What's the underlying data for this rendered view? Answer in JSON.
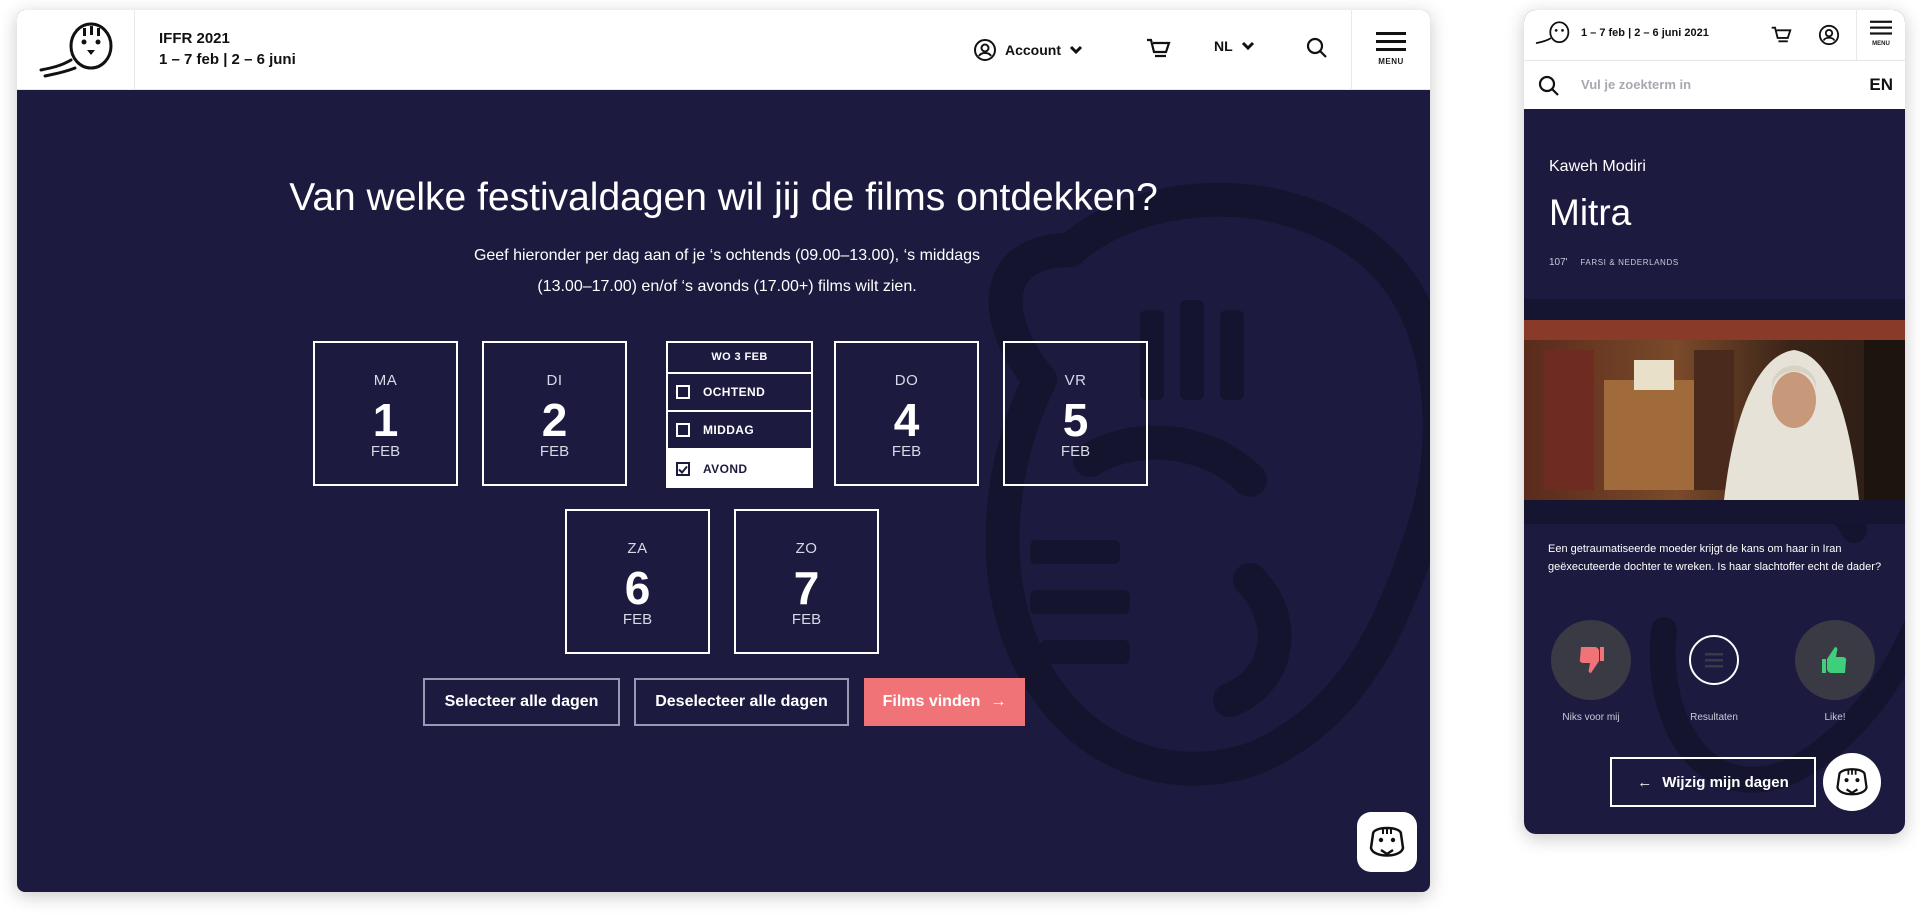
{
  "desktop": {
    "header": {
      "title": "IFFR 2021",
      "dates": "1 – 7 feb | 2 – 6 juni",
      "account_label": "Account",
      "language": "NL",
      "menu_label": "MENU"
    },
    "hero": {
      "title": "Van welke festivaldagen wil jij de films ontdekken?",
      "subtitle_line1": "Geef hieronder per dag aan of je ‘s ochtends (09.00–13.00), ‘s middags",
      "subtitle_line2": "(13.00–17.00) en/of ‘s avonds (17.00+) films wilt zien."
    },
    "days": [
      {
        "name": "MA",
        "num": "1",
        "month": "FEB"
      },
      {
        "name": "DI",
        "num": "2",
        "month": "FEB"
      },
      {
        "name": "DO",
        "num": "4",
        "month": "FEB"
      },
      {
        "name": "VR",
        "num": "5",
        "month": "FEB"
      },
      {
        "name": "ZA",
        "num": "6",
        "month": "FEB"
      },
      {
        "name": "ZO",
        "num": "7",
        "month": "FEB"
      }
    ],
    "open_day": {
      "header": "WO 3 FEB",
      "slots": [
        {
          "label": "OCHTEND",
          "checked": false
        },
        {
          "label": "MIDDAG",
          "checked": false
        },
        {
          "label": "AVOND",
          "checked": true
        }
      ]
    },
    "buttons": {
      "select_all": "Selecteer alle dagen",
      "deselect_all": "Deselecteer alle dagen",
      "find": "Films vinden",
      "find_arrow": "→"
    }
  },
  "mobile": {
    "header": {
      "dates": "1 – 7 feb | 2 – 6 juni 2021",
      "menu_label": "MENU"
    },
    "search": {
      "placeholder": "Vul je zoekterm in",
      "language": "EN"
    },
    "film": {
      "director": "Kaweh Modiri",
      "title": "Mitra",
      "duration": "107'",
      "languages": "FARSI & NEDERLANDS",
      "description": "Een getraumatiseerde moeder krijgt de kans om haar in Iran geëxecuteerde dochter te wreken. Is haar slachtoffer echt de dader?"
    },
    "actions": {
      "dislike": "Niks voor mij",
      "results": "Resultaten",
      "like": "Like!"
    },
    "change_days": "Wijzig mijn dagen",
    "change_days_arrow": "←"
  },
  "colors": {
    "navy": "#1c1b3f",
    "coral": "#f07377",
    "dislike": "#f07377",
    "like": "#3ecf7a"
  }
}
